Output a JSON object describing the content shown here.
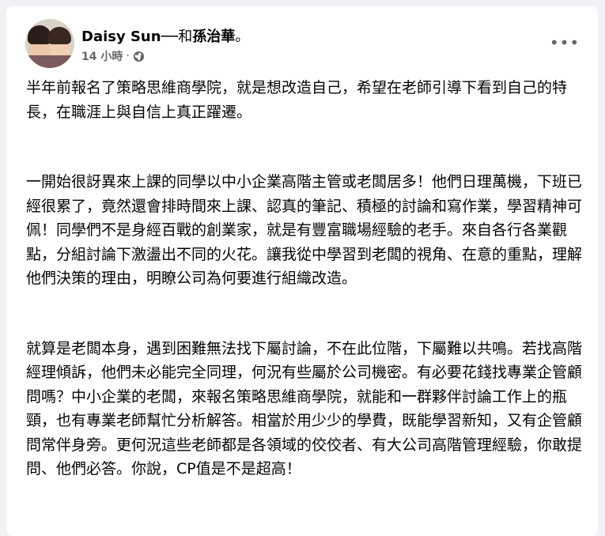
{
  "post": {
    "author": "Daisy Sun",
    "with_prefix": "──和",
    "with_name": "孫治華",
    "with_suffix": "。",
    "time": "14 小時",
    "separator": "·",
    "more_label": "•••",
    "paragraphs": [
      "半年前報名了策略思維商學院，就是想改造自己，希望在老師引導下看到自己的特長，在職涯上與自信上真正躍遷。",
      "一開始很訝異來上課的同學以中小企業高階主管或老闆居多！他們日理萬機，下班已經很累了，竟然還會排時間來上課、認真的筆記、積極的討論和寫作業，學習精神可佩！同學們不是身經百戰的創業家，就是有豐富職場經驗的老手。來自各行各業觀點，分組討論下激盪出不同的火花。讓我從中學習到老闆的視角、在意的重點，理解他們決策的理由，明瞭公司為何要進行組織改造。",
      "就算是老闆本身，遇到困難無法找下屬討論，不在此位階，下屬難以共鳴。若找高階經理傾訴，他們未必能完全同理，何況有些屬於公司機密。有必要花錢找專業企管顧問嗎？中小企業的老闆，來報名策略思維商學院，就能和一群夥伴討論工作上的瓶頸，也有專業老師幫忙分析解答。相當於用少少的學費，既能學習新知，又有企管顧問常伴身旁。更何況這些老師都是各領域的佼佼者、有大公司高階管理經驗，你敢提問、他們必答。你說，CP值是不是超高！"
    ]
  },
  "icons": {
    "avatar": "profile-photo",
    "privacy": "globe-icon",
    "more": "more-horizontal-icon"
  },
  "colors": {
    "text": "#050505",
    "secondary": "#65676b",
    "background": "#f0f2f5",
    "card": "#ffffff"
  }
}
